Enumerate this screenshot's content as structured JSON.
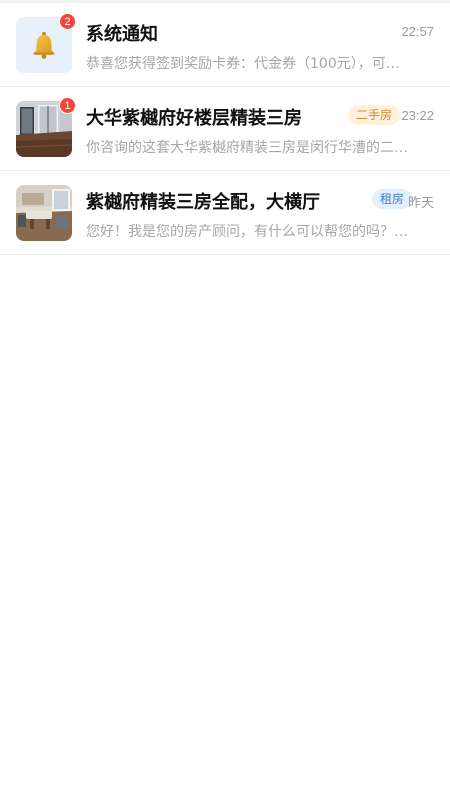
{
  "conversations": [
    {
      "title": "系统通知",
      "badge": "2",
      "time": "22:57",
      "preview": "恭喜您获得签到奖励卡券：代金券（100元），可…",
      "avatar_icon": "bell-icon"
    },
    {
      "title": "大华紫樾府好楼层精装三房",
      "badge": "1",
      "tag": "二手房",
      "time": "23:22",
      "preview": "你咨询的这套大华紫樾府精装三房是闵行华漕的二…",
      "avatar_icon": "apartment-photo"
    },
    {
      "title": "紫樾府精装三房全配，大横厅",
      "tag": "租房",
      "time": "昨天",
      "preview": "您好！我是您的房产顾问，有什么可以帮您的吗？…",
      "avatar_icon": "living-room-photo"
    }
  ],
  "colors": {
    "badge": "#f0463b",
    "tag_secondhand_bg": "#fff1dd",
    "tag_secondhand_text": "#d6882b",
    "tag_rent_bg": "#e3f0fb",
    "tag_rent_text": "#3f7fc3"
  }
}
